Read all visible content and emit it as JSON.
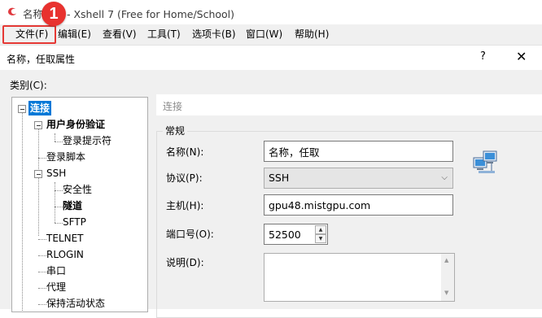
{
  "window": {
    "title": "名称，任 - Xshell 7 (Free for Home/School)"
  },
  "menubar": {
    "items": [
      "文件(F)",
      "编辑(E)",
      "查看(V)",
      "工具(T)",
      "选项卡(B)",
      "窗口(W)",
      "帮助(H)"
    ],
    "step_badge": "1"
  },
  "dialog": {
    "title": "名称，任取属性",
    "help": "?",
    "close": "✕",
    "category_label": "类别(C):",
    "tree": {
      "connection": "连接",
      "user_auth": "用户身份验证",
      "login_prompt": "登录提示符",
      "login_script": "登录脚本",
      "ssh": "SSH",
      "security": "安全性",
      "tunnel": "隧道",
      "sftp": "SFTP",
      "telnet": "TELNET",
      "rlogin": "RLOGIN",
      "serial": "串口",
      "proxy": "代理",
      "keepalive": "保持活动状态"
    },
    "breadcrumb": "连接",
    "group_title": "常规",
    "fields": {
      "name_label": "名称(N):",
      "name_value": "名称，任取",
      "protocol_label": "协议(P):",
      "protocol_value": "SSH",
      "host_label": "主机(H):",
      "host_value": "gpu48.mistgpu.com",
      "port_label": "端口号(O):",
      "port_value": "52500",
      "desc_label": "说明(D):",
      "desc_value": ""
    }
  },
  "colors": {
    "selection": "#0078d7",
    "highlight_border": "#e53935",
    "badge": "#e8322f"
  }
}
